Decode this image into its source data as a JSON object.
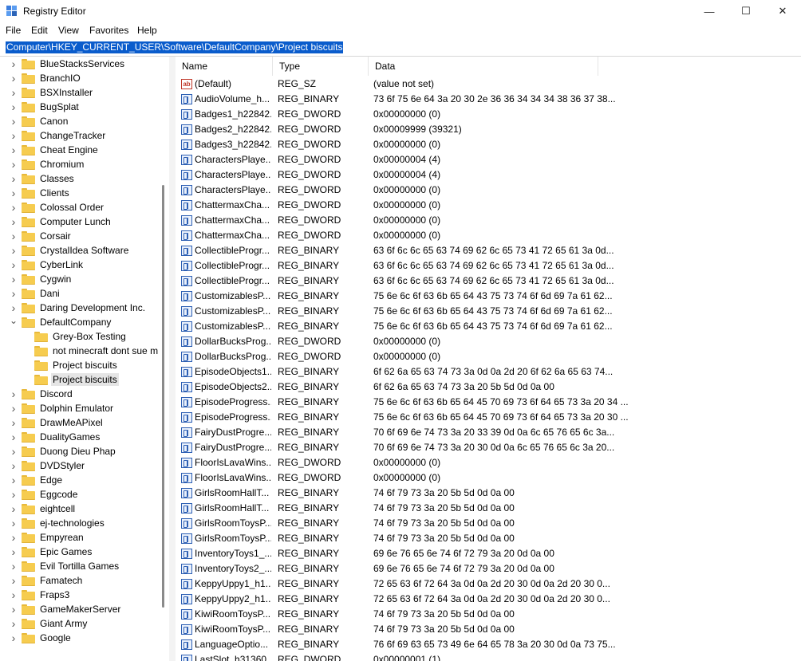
{
  "window": {
    "title": "Registry Editor"
  },
  "controls": {
    "minimize": "—",
    "maximize": "☐",
    "close": "✕"
  },
  "menu": [
    "File",
    "Edit",
    "View",
    "Favorites",
    "Help"
  ],
  "address": "Computer\\HKEY_CURRENT_USER\\Software\\DefaultCompany\\Project biscuits",
  "columns": {
    "name": "Name",
    "type": "Type",
    "data": "Data"
  },
  "tree": [
    {
      "label": "BlueStacksServices",
      "level": 0,
      "expander": "collapsed"
    },
    {
      "label": "BranchIO",
      "level": 0,
      "expander": "collapsed"
    },
    {
      "label": "BSXInstaller",
      "level": 0,
      "expander": "collapsed"
    },
    {
      "label": "BugSplat",
      "level": 0,
      "expander": "collapsed"
    },
    {
      "label": "Canon",
      "level": 0,
      "expander": "collapsed"
    },
    {
      "label": "ChangeTracker",
      "level": 0,
      "expander": "collapsed"
    },
    {
      "label": "Cheat Engine",
      "level": 0,
      "expander": "collapsed"
    },
    {
      "label": "Chromium",
      "level": 0,
      "expander": "collapsed"
    },
    {
      "label": "Classes",
      "level": 0,
      "expander": "collapsed"
    },
    {
      "label": "Clients",
      "level": 0,
      "expander": "collapsed"
    },
    {
      "label": "Colossal Order",
      "level": 0,
      "expander": "collapsed"
    },
    {
      "label": "Computer Lunch",
      "level": 0,
      "expander": "collapsed"
    },
    {
      "label": "Corsair",
      "level": 0,
      "expander": "collapsed"
    },
    {
      "label": "CrystalIdea Software",
      "level": 0,
      "expander": "collapsed"
    },
    {
      "label": "CyberLink",
      "level": 0,
      "expander": "collapsed"
    },
    {
      "label": "Cygwin",
      "level": 0,
      "expander": "collapsed"
    },
    {
      "label": "Dani",
      "level": 0,
      "expander": "collapsed"
    },
    {
      "label": "Daring Development Inc.",
      "level": 0,
      "expander": "collapsed"
    },
    {
      "label": "DefaultCompany",
      "level": 0,
      "expander": "expanded"
    },
    {
      "label": "Grey-Box Testing",
      "level": 1,
      "expander": "none"
    },
    {
      "label": "not minecraft dont sue m",
      "level": 1,
      "expander": "none"
    },
    {
      "label": "Project biscuits",
      "level": 1,
      "expander": "none"
    },
    {
      "label": "Project biscuits",
      "level": 1,
      "expander": "none",
      "selected": true
    },
    {
      "label": "Discord",
      "level": 0,
      "expander": "collapsed"
    },
    {
      "label": "Dolphin Emulator",
      "level": 0,
      "expander": "collapsed"
    },
    {
      "label": "DrawMeAPixel",
      "level": 0,
      "expander": "collapsed"
    },
    {
      "label": "DualityGames",
      "level": 0,
      "expander": "collapsed"
    },
    {
      "label": "Duong Dieu Phap",
      "level": 0,
      "expander": "collapsed"
    },
    {
      "label": "DVDStyler",
      "level": 0,
      "expander": "collapsed"
    },
    {
      "label": "Edge",
      "level": 0,
      "expander": "collapsed"
    },
    {
      "label": "Eggcode",
      "level": 0,
      "expander": "collapsed"
    },
    {
      "label": "eightcell",
      "level": 0,
      "expander": "collapsed"
    },
    {
      "label": "ej-technologies",
      "level": 0,
      "expander": "collapsed"
    },
    {
      "label": "Empyrean",
      "level": 0,
      "expander": "collapsed"
    },
    {
      "label": "Epic Games",
      "level": 0,
      "expander": "collapsed"
    },
    {
      "label": "Evil Tortilla Games",
      "level": 0,
      "expander": "collapsed"
    },
    {
      "label": "Famatech",
      "level": 0,
      "expander": "collapsed"
    },
    {
      "label": "Fraps3",
      "level": 0,
      "expander": "collapsed"
    },
    {
      "label": "GameMakerServer",
      "level": 0,
      "expander": "collapsed"
    },
    {
      "label": "Giant Army",
      "level": 0,
      "expander": "collapsed"
    },
    {
      "label": "Google",
      "level": 0,
      "expander": "collapsed"
    }
  ],
  "values": [
    {
      "name": "(Default)",
      "type": "REG_SZ",
      "data": "(value not set)",
      "icon": "string-value-icon"
    },
    {
      "name": "AudioVolume_h...",
      "type": "REG_BINARY",
      "data": "73 6f 75 6e 64 3a 20 30 2e 36 36 34 34 34 38 36 37 38...",
      "icon": "binary-value-icon"
    },
    {
      "name": "Badges1_h22842...",
      "type": "REG_DWORD",
      "data": "0x00000000 (0)",
      "icon": "binary-value-icon"
    },
    {
      "name": "Badges2_h22842...",
      "type": "REG_DWORD",
      "data": "0x00009999 (39321)",
      "icon": "binary-value-icon"
    },
    {
      "name": "Badges3_h22842...",
      "type": "REG_DWORD",
      "data": "0x00000000 (0)",
      "icon": "binary-value-icon"
    },
    {
      "name": "CharactersPlaye...",
      "type": "REG_DWORD",
      "data": "0x00000004 (4)",
      "icon": "binary-value-icon"
    },
    {
      "name": "CharactersPlaye...",
      "type": "REG_DWORD",
      "data": "0x00000004 (4)",
      "icon": "binary-value-icon"
    },
    {
      "name": "CharactersPlaye...",
      "type": "REG_DWORD",
      "data": "0x00000000 (0)",
      "icon": "binary-value-icon"
    },
    {
      "name": "ChattermaxCha...",
      "type": "REG_DWORD",
      "data": "0x00000000 (0)",
      "icon": "binary-value-icon"
    },
    {
      "name": "ChattermaxCha...",
      "type": "REG_DWORD",
      "data": "0x00000000 (0)",
      "icon": "binary-value-icon"
    },
    {
      "name": "ChattermaxCha...",
      "type": "REG_DWORD",
      "data": "0x00000000 (0)",
      "icon": "binary-value-icon"
    },
    {
      "name": "CollectibleProgr...",
      "type": "REG_BINARY",
      "data": "63 6f 6c 6c 65 63 74 69 62 6c 65 73 41 72 65 61 3a 0d...",
      "icon": "binary-value-icon"
    },
    {
      "name": "CollectibleProgr...",
      "type": "REG_BINARY",
      "data": "63 6f 6c 6c 65 63 74 69 62 6c 65 73 41 72 65 61 3a 0d...",
      "icon": "binary-value-icon"
    },
    {
      "name": "CollectibleProgr...",
      "type": "REG_BINARY",
      "data": "63 6f 6c 6c 65 63 74 69 62 6c 65 73 41 72 65 61 3a 0d...",
      "icon": "binary-value-icon"
    },
    {
      "name": "CustomizablesP...",
      "type": "REG_BINARY",
      "data": "75 6e 6c 6f 63 6b 65 64 43 75 73 74 6f 6d 69 7a 61 62...",
      "icon": "binary-value-icon"
    },
    {
      "name": "CustomizablesP...",
      "type": "REG_BINARY",
      "data": "75 6e 6c 6f 63 6b 65 64 43 75 73 74 6f 6d 69 7a 61 62...",
      "icon": "binary-value-icon"
    },
    {
      "name": "CustomizablesP...",
      "type": "REG_BINARY",
      "data": "75 6e 6c 6f 63 6b 65 64 43 75 73 74 6f 6d 69 7a 61 62...",
      "icon": "binary-value-icon"
    },
    {
      "name": "DollarBucksProg...",
      "type": "REG_DWORD",
      "data": "0x00000000 (0)",
      "icon": "binary-value-icon"
    },
    {
      "name": "DollarBucksProg...",
      "type": "REG_DWORD",
      "data": "0x00000000 (0)",
      "icon": "binary-value-icon"
    },
    {
      "name": "EpisodeObjects1...",
      "type": "REG_BINARY",
      "data": "6f 62 6a 65 63 74 73 3a 0d 0a 2d 20 6f 62 6a 65 63 74...",
      "icon": "binary-value-icon"
    },
    {
      "name": "EpisodeObjects2...",
      "type": "REG_BINARY",
      "data": "6f 62 6a 65 63 74 73 3a 20 5b 5d 0d 0a 00",
      "icon": "binary-value-icon"
    },
    {
      "name": "EpisodeProgress...",
      "type": "REG_BINARY",
      "data": "75 6e 6c 6f 63 6b 65 64 45 70 69 73 6f 64 65 73 3a 20 34 ...",
      "icon": "binary-value-icon"
    },
    {
      "name": "EpisodeProgress...",
      "type": "REG_BINARY",
      "data": "75 6e 6c 6f 63 6b 65 64 45 70 69 73 6f 64 65 73 3a 20 30 ...",
      "icon": "binary-value-icon"
    },
    {
      "name": "FairyDustProgre...",
      "type": "REG_BINARY",
      "data": "70 6f 69 6e 74 73 3a 20 33 39 0d 0a 6c 65 76 65 6c 3a...",
      "icon": "binary-value-icon"
    },
    {
      "name": "FairyDustProgre...",
      "type": "REG_BINARY",
      "data": "70 6f 69 6e 74 73 3a 20 30 0d 0a 6c 65 76 65 6c 3a 20...",
      "icon": "binary-value-icon"
    },
    {
      "name": "FloorIsLavaWins...",
      "type": "REG_DWORD",
      "data": "0x00000000 (0)",
      "icon": "binary-value-icon"
    },
    {
      "name": "FloorIsLavaWins...",
      "type": "REG_DWORD",
      "data": "0x00000000 (0)",
      "icon": "binary-value-icon"
    },
    {
      "name": "GirlsRoomHallT...",
      "type": "REG_BINARY",
      "data": "74 6f 79 73 3a 20 5b 5d 0d 0a 00",
      "icon": "binary-value-icon"
    },
    {
      "name": "GirlsRoomHallT...",
      "type": "REG_BINARY",
      "data": "74 6f 79 73 3a 20 5b 5d 0d 0a 00",
      "icon": "binary-value-icon"
    },
    {
      "name": "GirlsRoomToysP...",
      "type": "REG_BINARY",
      "data": "74 6f 79 73 3a 20 5b 5d 0d 0a 00",
      "icon": "binary-value-icon"
    },
    {
      "name": "GirlsRoomToysP...",
      "type": "REG_BINARY",
      "data": "74 6f 79 73 3a 20 5b 5d 0d 0a 00",
      "icon": "binary-value-icon"
    },
    {
      "name": "InventoryToys1_...",
      "type": "REG_BINARY",
      "data": "69 6e 76 65 6e 74 6f 72 79 3a 20 0d 0a 00",
      "icon": "binary-value-icon"
    },
    {
      "name": "InventoryToys2_...",
      "type": "REG_BINARY",
      "data": "69 6e 76 65 6e 74 6f 72 79 3a 20 0d 0a 00",
      "icon": "binary-value-icon"
    },
    {
      "name": "KeppyUppy1_h1...",
      "type": "REG_BINARY",
      "data": "72 65 63 6f 72 64 3a 0d 0a 2d 20 30 0d 0a 2d 20 30 0...",
      "icon": "binary-value-icon"
    },
    {
      "name": "KeppyUppy2_h1...",
      "type": "REG_BINARY",
      "data": "72 65 63 6f 72 64 3a 0d 0a 2d 20 30 0d 0a 2d 20 30 0...",
      "icon": "binary-value-icon"
    },
    {
      "name": "KiwiRoomToysP...",
      "type": "REG_BINARY",
      "data": "74 6f 79 73 3a 20 5b 5d 0d 0a 00",
      "icon": "binary-value-icon"
    },
    {
      "name": "KiwiRoomToysP...",
      "type": "REG_BINARY",
      "data": "74 6f 79 73 3a 20 5b 5d 0d 0a 00",
      "icon": "binary-value-icon"
    },
    {
      "name": "LanguageOptio...",
      "type": "REG_BINARY",
      "data": "76 6f 69 63 65 73 49 6e 64 65 78 3a 20 30 0d 0a 73 75...",
      "icon": "binary-value-icon"
    },
    {
      "name": "LastSlot_h31360...",
      "type": "REG_DWORD",
      "data": "0x00000001 (1)",
      "icon": "binary-value-icon"
    }
  ]
}
